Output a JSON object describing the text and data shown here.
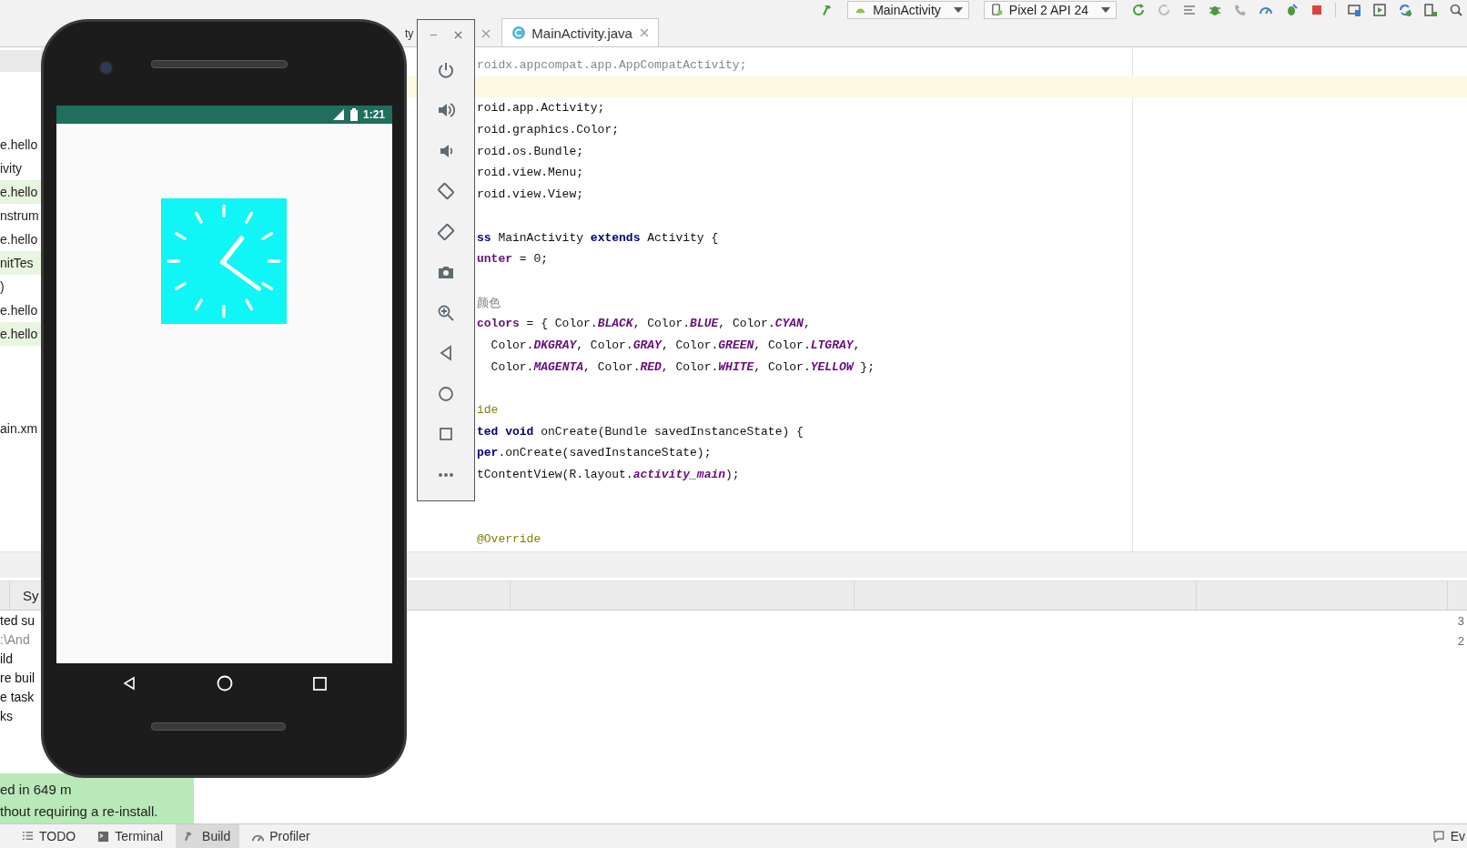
{
  "toolbar": {
    "run_config": "MainActivity",
    "device": "Pixel 2 API 24"
  },
  "editor_tabs": [
    {
      "label": "ty",
      "selected": false
    },
    {
      "label": "MainActivity.java",
      "selected": true
    }
  ],
  "project_tree": {
    "sections": [
      {
        "items": [
          {
            "label": "e.hello",
            "highlighted": false
          },
          {
            "label": "ivity",
            "highlighted": false
          },
          {
            "label": "e.hello",
            "highlighted": true
          },
          {
            "label": "nstrum",
            "highlighted": false
          },
          {
            "label": "e.hello",
            "highlighted": false
          },
          {
            "label": "nitTes",
            "highlighted": true
          },
          {
            "label": ")",
            "highlighted": false
          },
          {
            "label": "e.hello",
            "highlighted": false
          },
          {
            "label": "e.hello",
            "highlighted": true
          }
        ]
      },
      {
        "items": [
          {
            "label": "ain.xm",
            "highlighted": false
          }
        ]
      }
    ]
  },
  "code_lines": [
    {
      "highlighted": false,
      "segments": [
        {
          "text": "roidx.appcompat.app.AppCompatActivity;",
          "kind": "unused"
        }
      ]
    },
    {
      "highlighted": true
    },
    {
      "highlighted": false,
      "segments": [
        {
          "text": "roid.app.Activity;",
          "kind": "plain"
        }
      ]
    },
    {
      "highlighted": false,
      "segments": [
        {
          "text": "roid.graphics.Color;",
          "kind": "plain"
        }
      ]
    },
    {
      "highlighted": false,
      "segments": [
        {
          "text": "roid.os.Bundle;",
          "kind": "plain"
        }
      ]
    },
    {
      "highlighted": false,
      "segments": [
        {
          "text": "roid.view.Menu;",
          "kind": "plain"
        }
      ]
    },
    {
      "highlighted": false,
      "segments": [
        {
          "text": "roid.view.View;",
          "kind": "plain"
        }
      ]
    },
    {
      "highlighted": false
    },
    {
      "highlighted": false,
      "segments": [
        {
          "text": "ss",
          "kind": "keyword"
        },
        {
          "text": " MainActivity ",
          "kind": "plain"
        },
        {
          "text": "extends",
          "kind": "keyword"
        },
        {
          "text": " Activity {",
          "kind": "plain"
        }
      ]
    },
    {
      "highlighted": false,
      "segments": [
        {
          "text": "unter",
          "kind": "field"
        },
        {
          "text": " = 0;",
          "kind": "plain"
        }
      ]
    },
    {
      "highlighted": false
    },
    {
      "highlighted": false,
      "segments": [
        {
          "text": "颜色",
          "kind": "comment"
        }
      ]
    },
    {
      "highlighted": false,
      "segments": [
        {
          "text": "colors",
          "kind": "field"
        },
        {
          "text": " = { Color.",
          "kind": "plain"
        },
        {
          "text": "BLACK",
          "kind": "constant"
        },
        {
          "text": ", Color.",
          "kind": "plain"
        },
        {
          "text": "BLUE",
          "kind": "constant"
        },
        {
          "text": ", Color.",
          "kind": "plain"
        },
        {
          "text": "CYAN",
          "kind": "constant"
        },
        {
          "text": ",",
          "kind": "plain"
        }
      ]
    },
    {
      "highlighted": false,
      "segments": [
        {
          "text": "  Color.",
          "kind": "plain"
        },
        {
          "text": "DKGRAY",
          "kind": "constant"
        },
        {
          "text": ", Color.",
          "kind": "plain"
        },
        {
          "text": "GRAY",
          "kind": "constant"
        },
        {
          "text": ", Color.",
          "kind": "plain"
        },
        {
          "text": "GREEN",
          "kind": "constant"
        },
        {
          "text": ", Color.",
          "kind": "plain"
        },
        {
          "text": "LTGRAY",
          "kind": "constant"
        },
        {
          "text": ",",
          "kind": "plain"
        }
      ]
    },
    {
      "highlighted": false,
      "segments": [
        {
          "text": "  Color.",
          "kind": "plain"
        },
        {
          "text": "MAGENTA",
          "kind": "constant"
        },
        {
          "text": ", Color.",
          "kind": "plain"
        },
        {
          "text": "RED",
          "kind": "constant"
        },
        {
          "text": ", Color.",
          "kind": "plain"
        },
        {
          "text": "WHITE",
          "kind": "constant"
        },
        {
          "text": ", Color.",
          "kind": "plain"
        },
        {
          "text": "YELLOW",
          "kind": "constant"
        },
        {
          "text": " };",
          "kind": "plain"
        }
      ]
    },
    {
      "highlighted": false
    },
    {
      "highlighted": false,
      "segments": [
        {
          "text": "ide",
          "kind": "annotation"
        }
      ]
    },
    {
      "highlighted": false,
      "segments": [
        {
          "text": "ted void",
          "kind": "keyword"
        },
        {
          "text": " onCreate(Bundle savedInstanceState) {",
          "kind": "plain"
        }
      ]
    },
    {
      "highlighted": false,
      "segments": [
        {
          "text": "per",
          "kind": "keyword"
        },
        {
          "text": ".onCreate(savedInstanceState);",
          "kind": "plain"
        }
      ]
    },
    {
      "highlighted": false,
      "segments": [
        {
          "text": "tContentView(R.layout.",
          "kind": "plain"
        },
        {
          "text": "activity_main",
          "kind": "constant"
        },
        {
          "text": ");",
          "kind": "plain"
        }
      ]
    },
    {
      "highlighted": false
    },
    {
      "highlighted": false
    },
    {
      "highlighted": false,
      "segments": [
        {
          "text": "@Override",
          "kind": "annotation"
        }
      ]
    }
  ],
  "build_panel": {
    "tab": "Sy",
    "output": [
      {
        "text": "ted su",
        "kind": "normal"
      },
      {
        "text": ":\\And",
        "kind": "path"
      },
      {
        "text": "ild",
        "kind": "normal"
      },
      {
        "text": "re buil",
        "kind": "normal"
      },
      {
        "text": "e task",
        "kind": "normal"
      },
      {
        "text": "ks",
        "kind": "normal"
      }
    ],
    "counts": [
      "3",
      "2"
    ]
  },
  "notification": {
    "lines": [
      "ed in 649 m",
      "thout requiring a re-install."
    ]
  },
  "emulator": {
    "status_time": "1:21"
  },
  "tool_windows": [
    {
      "label": "TODO",
      "selected": false
    },
    {
      "label": "Terminal",
      "selected": false
    },
    {
      "label": "Build",
      "selected": true
    },
    {
      "label": "Profiler",
      "selected": false
    }
  ],
  "event_log": "Ev"
}
